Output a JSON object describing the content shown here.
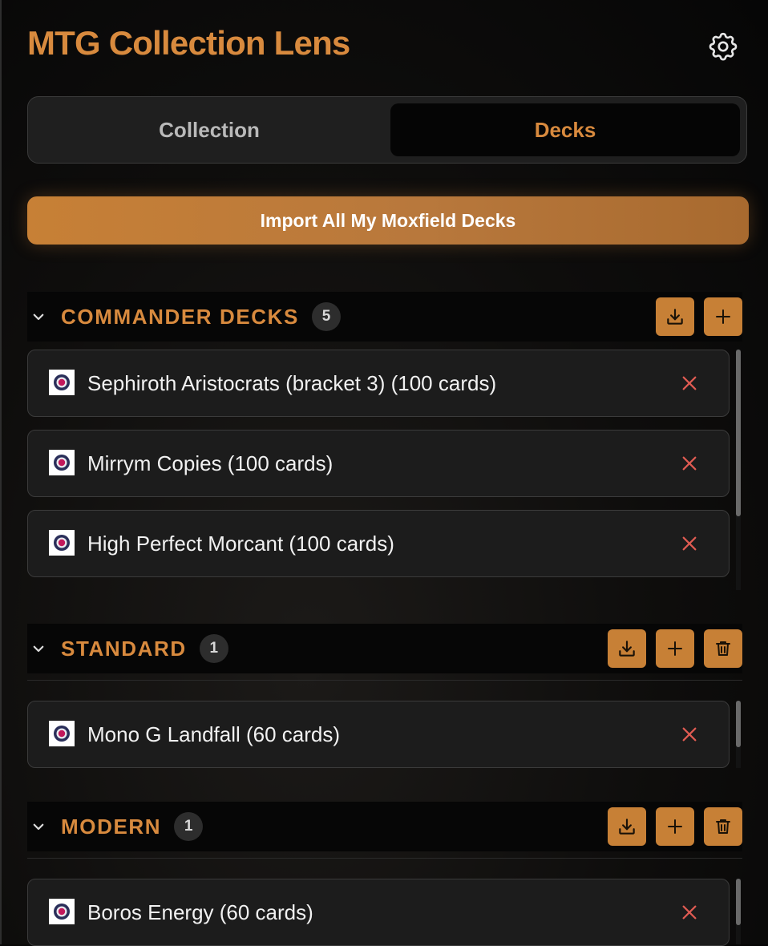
{
  "app": {
    "title": "MTG Collection Lens"
  },
  "tabs": [
    {
      "label": "Collection",
      "active": false
    },
    {
      "label": "Decks",
      "active": true
    }
  ],
  "import_button": {
    "label": "Import All My Moxfield Decks"
  },
  "sections": [
    {
      "title": "COMMANDER DECKS",
      "count": "5",
      "actions": [
        "download-icon",
        "plus-icon"
      ],
      "decks": [
        {
          "name": "Sephiroth Aristocrats (bracket 3) (100 cards)"
        },
        {
          "name": "Mirrym Copies (100 cards)"
        },
        {
          "name": "High Perfect Morcant (100 cards)"
        }
      ]
    },
    {
      "title": "STANDARD",
      "count": "1",
      "actions": [
        "download-icon",
        "plus-icon",
        "trash-icon"
      ],
      "decks": [
        {
          "name": "Mono G Landfall (60 cards)"
        }
      ]
    },
    {
      "title": "MODERN",
      "count": "1",
      "actions": [
        "download-icon",
        "plus-icon",
        "trash-icon"
      ],
      "decks": [
        {
          "name": "Boros Energy (60 cards)"
        }
      ]
    }
  ],
  "colors": {
    "accent": "#d88a3e",
    "button": "#c78036",
    "remove": "#e05b52",
    "background": "#0e0d0c",
    "row": "#1c1c1c"
  }
}
